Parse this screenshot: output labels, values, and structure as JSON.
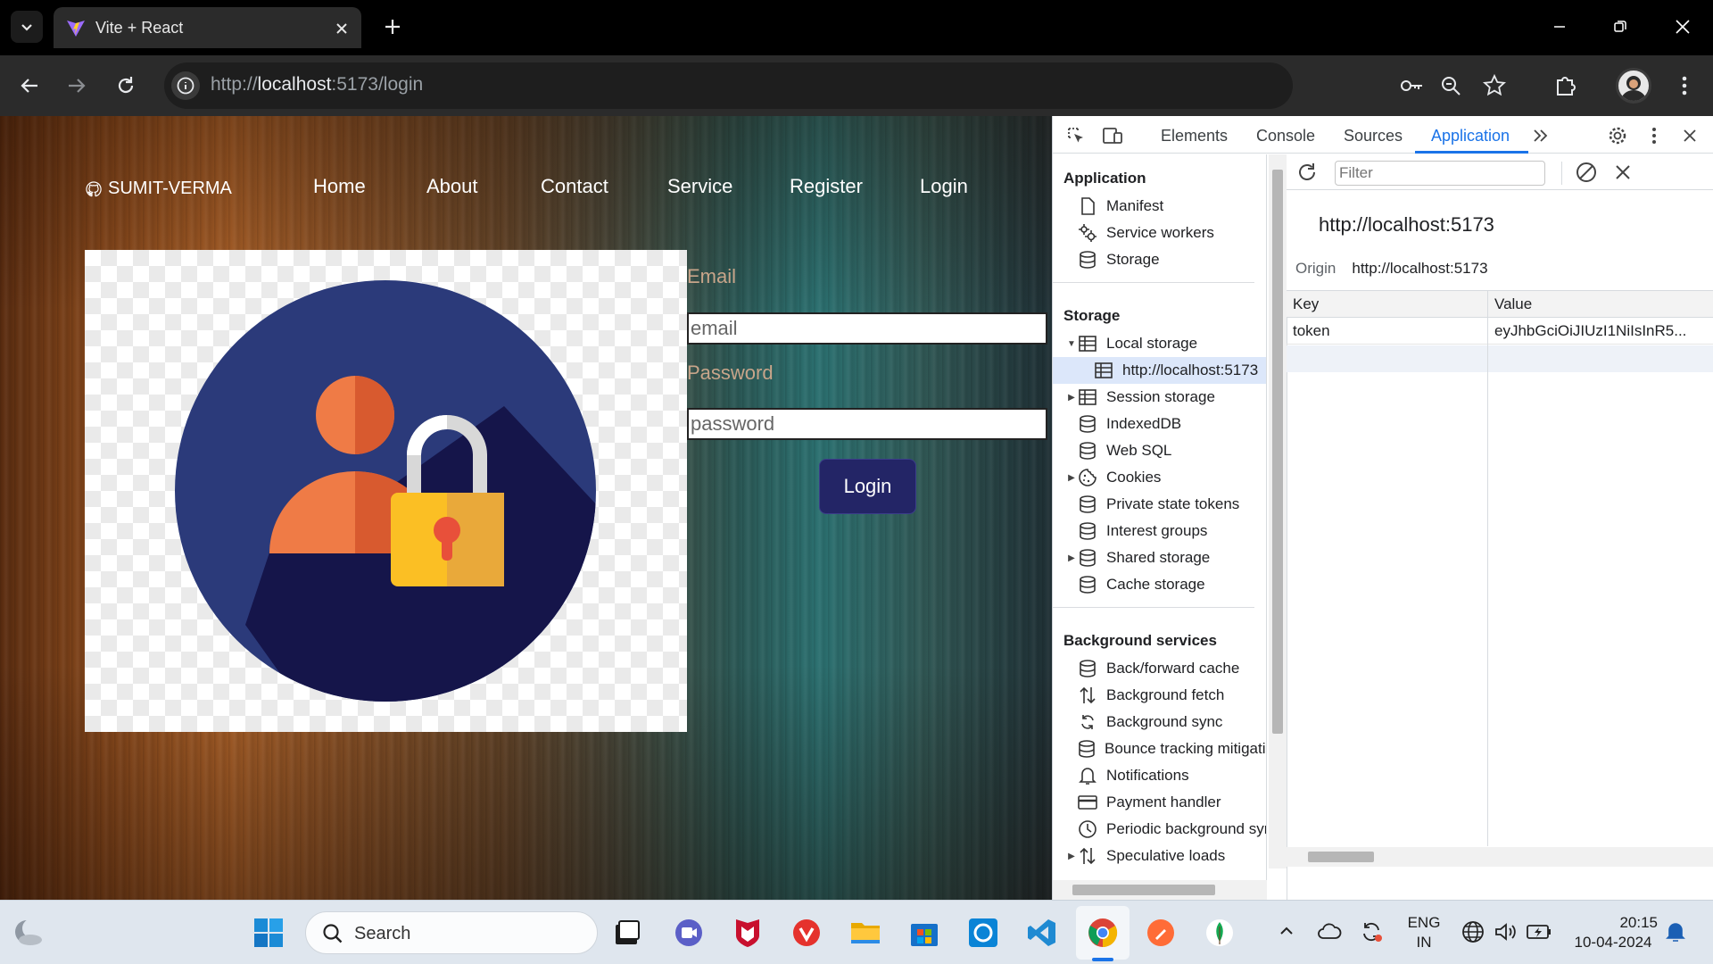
{
  "browser": {
    "tab_title": "Vite + React",
    "url_prefix": "http://",
    "url_host": "localhost",
    "url_rest": ":5173/login"
  },
  "page": {
    "brand": "SUMIT-VERMA",
    "nav": [
      "Home",
      "About",
      "Contact",
      "Service",
      "Register",
      "Login"
    ],
    "form": {
      "email_label": "Email",
      "email_placeholder": "email",
      "password_label": "Password",
      "password_placeholder": "password",
      "submit_label": "Login"
    }
  },
  "devtools": {
    "tabs": [
      "Elements",
      "Console",
      "Sources",
      "Application"
    ],
    "active_tab": "Application",
    "sidebar": {
      "application_header": "Application",
      "application_items": [
        "Manifest",
        "Service workers",
        "Storage"
      ],
      "storage_header": "Storage",
      "storage_items": [
        "Local storage",
        "http://localhost:5173",
        "Session storage",
        "IndexedDB",
        "Web SQL",
        "Cookies",
        "Private state tokens",
        "Interest groups",
        "Shared storage",
        "Cache storage"
      ],
      "background_header": "Background services",
      "background_items": [
        "Back/forward cache",
        "Background fetch",
        "Background sync",
        "Bounce tracking mitigations",
        "Notifications",
        "Payment handler",
        "Periodic background sync",
        "Speculative loads"
      ]
    },
    "filter_placeholder": "Filter",
    "origin_title": "http://localhost:5173",
    "origin_key": "Origin",
    "origin_value": "http://localhost:5173",
    "table": {
      "headers": [
        "Key",
        "Value"
      ],
      "rows": [
        {
          "key": "token",
          "value": "eyJhbGciOiJIUzI1NiIsInR5..."
        }
      ]
    }
  },
  "taskbar": {
    "search_label": "Search",
    "lang_top": "ENG",
    "lang_bottom": "IN",
    "time": "20:15",
    "date": "10-04-2024"
  },
  "colors": {
    "accent": "#1a73e8",
    "login_button": "#232566",
    "avatar_circle": "#2b3a7a"
  }
}
